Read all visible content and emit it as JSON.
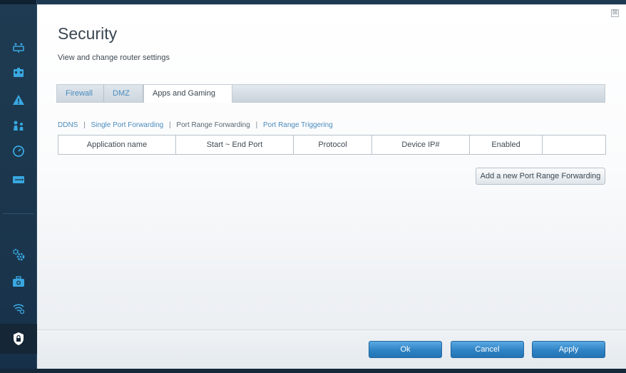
{
  "sidebar": {
    "items": [
      {
        "name": "network-map-icon"
      },
      {
        "name": "router-icon"
      },
      {
        "name": "warning-icon"
      },
      {
        "name": "parental-controls-icon"
      },
      {
        "name": "speed-test-icon"
      },
      {
        "name": "usb-storage-icon"
      },
      {
        "name": "settings-gears-icon"
      },
      {
        "name": "toolbox-icon"
      },
      {
        "name": "wireless-icon"
      },
      {
        "name": "security-lock-icon",
        "active": true
      }
    ]
  },
  "page": {
    "title": "Security",
    "subtitle": "View and change router settings"
  },
  "tabs": [
    {
      "label": "Firewall",
      "active": false
    },
    {
      "label": "DMZ",
      "active": false
    },
    {
      "label": "Apps and Gaming",
      "active": true
    }
  ],
  "subnav": {
    "items": [
      {
        "label": "DDNS",
        "current": false
      },
      {
        "label": "Single Port Forwarding",
        "current": false
      },
      {
        "label": "Port Range Forwarding",
        "current": true
      },
      {
        "label": "Port Range Triggering",
        "current": false
      }
    ],
    "separator": "|"
  },
  "table": {
    "columns": [
      "Application name",
      "Start ~ End Port",
      "Protocol",
      "Device IP#",
      "Enabled",
      ""
    ]
  },
  "add_button": {
    "label": "Add a new Port Range Forwarding"
  },
  "footer": {
    "ok_label": "Ok",
    "cancel_label": "Cancel",
    "apply_label": "Apply"
  },
  "window": {
    "close_glyph": "⊠"
  },
  "colors": {
    "accent": "#2f83c4",
    "link": "#4b8bbd",
    "sidebar_bg": "#1e3b52"
  }
}
